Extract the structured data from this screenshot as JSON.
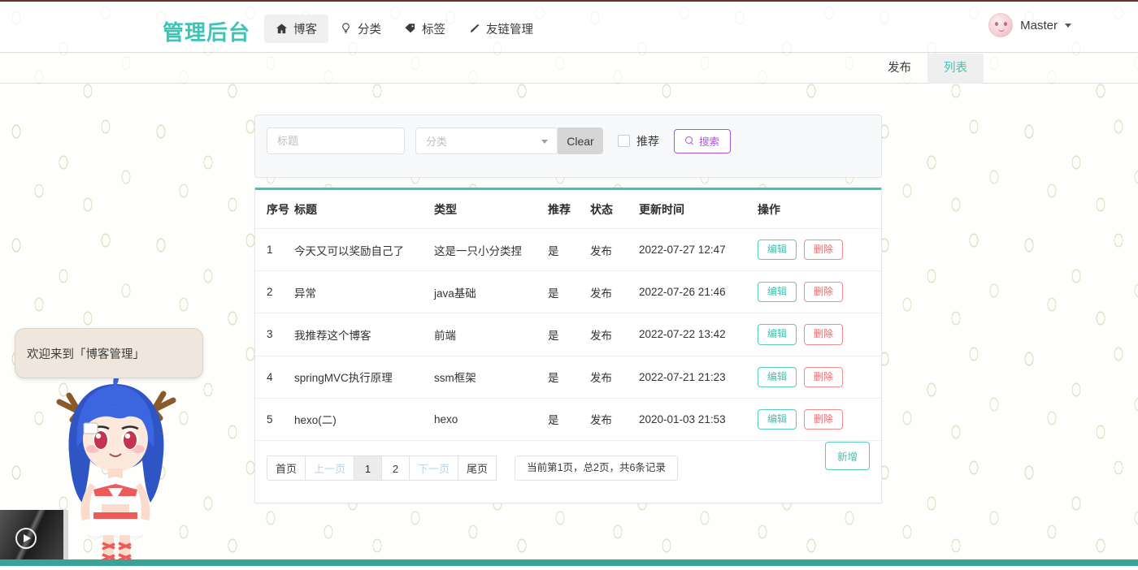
{
  "brand": "管理后台",
  "nav": {
    "items": [
      {
        "label": "博客",
        "icon": "home-icon",
        "active": true
      },
      {
        "label": "分类",
        "icon": "lightbulb-icon",
        "active": false
      },
      {
        "label": "标签",
        "icon": "tag-icon",
        "active": false
      },
      {
        "label": "友链管理",
        "icon": "pencil-icon",
        "active": false
      }
    ]
  },
  "user": {
    "name": "Master",
    "avatar": "pink-face-avatar",
    "caret": "chevron-down-icon"
  },
  "subtabs": [
    {
      "label": "发布",
      "active": false
    },
    {
      "label": "列表",
      "active": true
    }
  ],
  "search": {
    "title_placeholder": "标题",
    "title_value": "",
    "category_placeholder": "分类",
    "category_value": "",
    "clear_label": "Clear",
    "recommend_label": "推荐",
    "recommend_checked": false,
    "search_label": "搜索",
    "search_icon": "magnifier-icon"
  },
  "table": {
    "headers": [
      "序号",
      "标题",
      "类型",
      "推荐",
      "状态",
      "更新时间",
      "操作"
    ],
    "edit_label": "编辑",
    "delete_label": "删除",
    "rows": [
      {
        "idx": "1",
        "title": "今天又可以奖励自己了",
        "type": "这是一只小分类捏",
        "rec": "是",
        "state": "发布",
        "time": "2022-07-27 12:47"
      },
      {
        "idx": "2",
        "title": "异常",
        "type": "java基础",
        "rec": "是",
        "state": "发布",
        "time": "2022-07-26 21:46"
      },
      {
        "idx": "3",
        "title": "我推荐这个博客",
        "type": "前端",
        "rec": "是",
        "state": "发布",
        "time": "2022-07-22 13:42"
      },
      {
        "idx": "4",
        "title": "springMVC执行原理",
        "type": "ssm框架",
        "rec": "是",
        "state": "发布",
        "time": "2022-07-21 21:23"
      },
      {
        "idx": "5",
        "title": "hexo(二)",
        "type": "hexo",
        "rec": "是",
        "state": "发布",
        "time": "2020-01-03 21:53"
      }
    ]
  },
  "pagination": {
    "first": "首页",
    "prev": "上一页",
    "pages": [
      "1",
      "2"
    ],
    "active_page": "1",
    "next": "下一页",
    "last": "尾页",
    "info": "当前第1页，总2页，共6条记录"
  },
  "add_button": "新增",
  "mascot": {
    "bubble_text": "欢迎来到「博客管理」"
  },
  "player": {
    "play_icon": "play-icon",
    "expand_icon": "chevron-right-icon"
  },
  "colors": {
    "brand_teal": "#3ec3b5",
    "accent_purple": "#a855d8",
    "danger_red": "#ef6a6a",
    "top_hairline": "#6b2d2d",
    "bottom_bar": "#3aa397",
    "leaf_pattern": "#b7bb78"
  }
}
